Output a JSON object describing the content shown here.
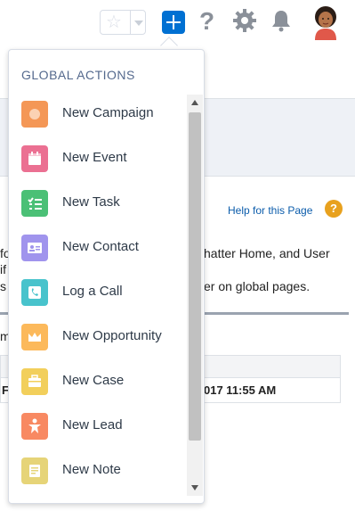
{
  "header": {
    "favorites_icon": "star-icon",
    "global_actions_icon": "plus-icon",
    "help_icon": "question-icon",
    "setup_icon": "gear-icon",
    "notifications_icon": "bell-icon",
    "avatar": "user-avatar"
  },
  "background_page": {
    "help_link": "Help for this Page",
    "help_badge": "?",
    "text_line1_right": "hatter Home, and User",
    "text_line2_right": "er on global pages.",
    "left_fragments": [
      "fo",
      "if",
      "s",
      "m"
    ],
    "row_left": "F",
    "row_date": "017 11:55 AM"
  },
  "menu": {
    "title": "GLOBAL ACTIONS",
    "items": [
      {
        "label": "New Campaign",
        "icon": "campaign-icon",
        "color": "#f49756"
      },
      {
        "label": "New Event",
        "icon": "calendar-icon",
        "color": "#eb7092"
      },
      {
        "label": "New Task",
        "icon": "task-list-icon",
        "color": "#4bc076"
      },
      {
        "label": "New Contact",
        "icon": "contact-card-icon",
        "color": "#a094ed"
      },
      {
        "label": "Log a Call",
        "icon": "phone-icon",
        "color": "#48c3cc"
      },
      {
        "label": "New Opportunity",
        "icon": "crown-icon",
        "color": "#fcb95b"
      },
      {
        "label": "New Case",
        "icon": "case-briefcase-icon",
        "color": "#f2cf5b"
      },
      {
        "label": "New Lead",
        "icon": "lead-person-icon",
        "color": "#f88962"
      },
      {
        "label": "New Note",
        "icon": "note-icon",
        "color": "#e6d478"
      }
    ]
  },
  "colors": {
    "accent": "#0070d2",
    "help_badge": "#e8a11e",
    "link": "#0b5cab"
  }
}
